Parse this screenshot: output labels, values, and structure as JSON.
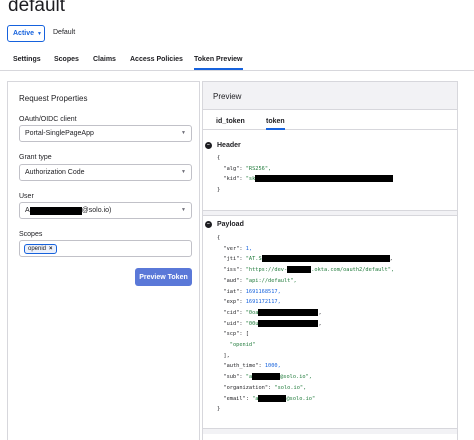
{
  "page": {
    "title": "default"
  },
  "status_button": {
    "label": "Active",
    "chevron_icon": "chevron-down-icon"
  },
  "default_label": "Default",
  "tabs": [
    {
      "label": "Settings"
    },
    {
      "label": "Scopes"
    },
    {
      "label": "Claims"
    },
    {
      "label": "Access Policies"
    },
    {
      "label": "Token Preview"
    }
  ],
  "request_properties": {
    "title": "Request Properties",
    "client_label": "OAuth/OIDC client",
    "client_value": "Portal-SinglePageApp",
    "grant_label": "Grant type",
    "grant_value": "Authorization Code",
    "user_label": "User",
    "user_prefix": "A",
    "user_suffix": "@solo.io)",
    "scopes_label": "Scopes",
    "scope_chip": "openid",
    "chip_close": "×",
    "preview_button": "Preview Token"
  },
  "preview": {
    "title": "Preview",
    "subtabs": [
      {
        "label": "id_token"
      },
      {
        "label": "token"
      }
    ],
    "header_title": "Header",
    "header": {
      "open": "{",
      "alg_key": "\"alg\": ",
      "alg_val": "\"RS256\",",
      "kid_key": "\"kid\": ",
      "kid_val": "\"sk",
      "close": "}"
    },
    "payload_title": "Payload",
    "payload": {
      "open": "{",
      "ver_key": "\"ver\": ",
      "ver_val": "1,",
      "jti_key": "\"jti\": ",
      "jti_val": "\"AT.S",
      "jti_end": ",",
      "iss_key": "\"iss\": ",
      "iss_val": "\"https://dev-",
      "iss_val2": ".okta.com/oauth2/default\",",
      "aud_key": "\"aud\": ",
      "aud_val": "\"api://default\",",
      "iat_key": "\"iat\": ",
      "iat_val": "1691168517,",
      "exp_key": "\"exp\": ",
      "exp_val": "1691172117,",
      "cid_key": "\"cid\": ",
      "cid_val": "\"0oa",
      "cid_end": ",",
      "uid_key": "\"uid\": ",
      "uid_val": "\"00u",
      "uid_end": ",",
      "scp_key": "\"scp\": [",
      "scp_val": "\"openid\"",
      "scp_close": "],",
      "auth_time_key": "\"auth_time\": ",
      "auth_time_val": "1000,",
      "sub_key": "\"sub\": ",
      "sub_val": "\"a",
      "sub_val2": "@solo.io\",",
      "org_key": "\"organization\": ",
      "org_val": "\"solo.io\",",
      "email_key": "\"email\": ",
      "email_val": "\"a",
      "email_val2": "@solo.io\"",
      "close": "}"
    }
  },
  "icons": {
    "collapse": "minus-circle-icon",
    "select_arrow": "caret-down-icon"
  }
}
